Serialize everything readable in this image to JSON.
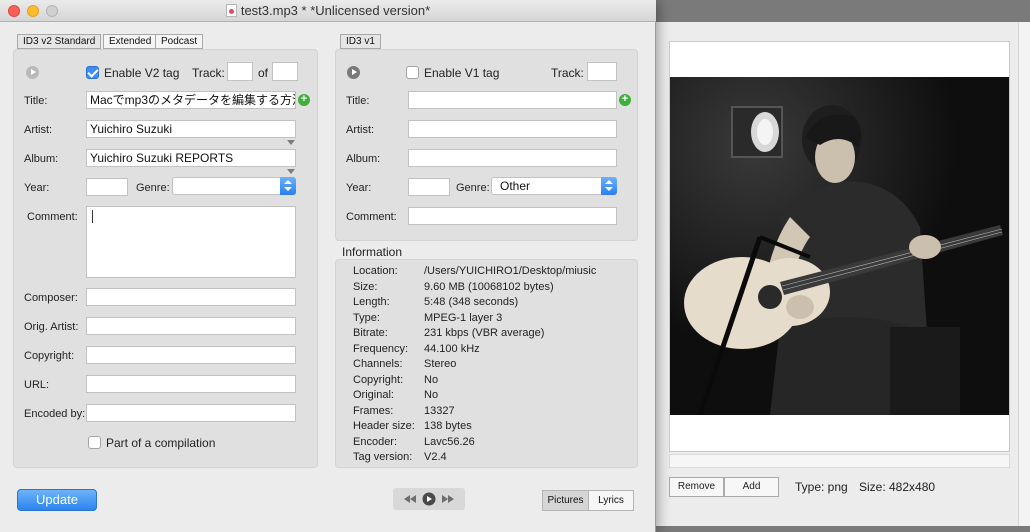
{
  "window": {
    "title": "test3.mp3 * *Unlicensed version*"
  },
  "tabs_v2": [
    {
      "label": "ID3 v2 Standard",
      "active": true
    },
    {
      "label": "Extended",
      "active": false
    },
    {
      "label": "Podcast",
      "active": false
    }
  ],
  "tabs_v1": [
    {
      "label": "ID3 v1",
      "active": true
    }
  ],
  "v2": {
    "enable_label": "Enable V2 tag",
    "enabled": true,
    "track_label": "Track:",
    "track_value": "",
    "of_label": "of",
    "of_value": "",
    "title_label": "Title:",
    "title_value": "Macでmp3のメタデータを編集する方法",
    "artist_label": "Artist:",
    "artist_value": "Yuichiro Suzuki",
    "album_label": "Album:",
    "album_value": "Yuichiro Suzuki REPORTS",
    "year_label": "Year:",
    "year_value": "",
    "genre_label": "Genre:",
    "genre_value": "",
    "comment_label": "Comment:",
    "comment_value": "",
    "composer_label": "Composer:",
    "composer_value": "",
    "orig_artist_label": "Orig. Artist:",
    "orig_artist_value": "",
    "copyright_label": "Copyright:",
    "copyright_value": "",
    "url_label": "URL:",
    "url_value": "",
    "encoded_by_label": "Encoded by:",
    "encoded_by_value": "",
    "compilation_label": "Part of a compilation",
    "compilation_checked": false
  },
  "v1": {
    "enable_label": "Enable V1 tag",
    "enabled": false,
    "track_label": "Track:",
    "track_value": "",
    "title_label": "Title:",
    "title_value": "",
    "artist_label": "Artist:",
    "artist_value": "",
    "album_label": "Album:",
    "album_value": "",
    "year_label": "Year:",
    "year_value": "",
    "genre_label": "Genre:",
    "genre_value": "Other",
    "comment_label": "Comment:",
    "comment_value": ""
  },
  "information": {
    "heading": "Information",
    "rows": [
      {
        "key": "Location:",
        "value": "/Users/YUICHIRO1/Desktop/miusic"
      },
      {
        "key": "Size:",
        "value": "9.60 MB (10068102 bytes)"
      },
      {
        "key": "Length:",
        "value": "5:48 (348 seconds)"
      },
      {
        "key": "Type:",
        "value": "MPEG-1 layer 3"
      },
      {
        "key": "Bitrate:",
        "value": "231 kbps (VBR average)"
      },
      {
        "key": "Frequency:",
        "value": "44.100 kHz"
      },
      {
        "key": "Channels:",
        "value": "Stereo"
      },
      {
        "key": "Copyright:",
        "value": "No"
      },
      {
        "key": "Original:",
        "value": "No"
      },
      {
        "key": "Frames:",
        "value": "13327"
      },
      {
        "key": "Header size:",
        "value": "138 bytes"
      },
      {
        "key": "Encoder:",
        "value": "Lavc56.26"
      },
      {
        "key": "Tag version:",
        "value": "V2.4"
      }
    ]
  },
  "footer": {
    "update_label": "Update",
    "pictures_label": "Pictures",
    "lyrics_label": "Lyrics"
  },
  "picture_panel": {
    "remove_label": "Remove",
    "add_label": "Add",
    "type_text": "Type: png",
    "size_text": "Size: 482x480"
  },
  "colors": {
    "accent_blue": "#2c84ef",
    "plus_green": "#3fae3a",
    "close_red": "#fc5f57",
    "minimize_yellow": "#fdbc2e"
  }
}
